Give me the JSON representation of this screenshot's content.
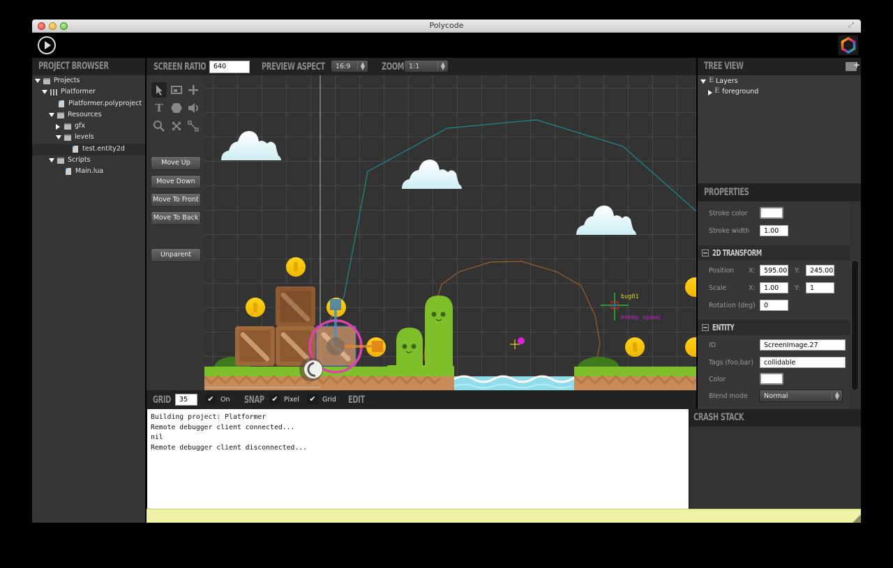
{
  "window": {
    "title": "Polycode"
  },
  "toolbar": {
    "play_icon": "play-circle-icon",
    "logo_icon": "polycode-hexagon-logo"
  },
  "project_browser": {
    "header": "PROJECT BROWSER",
    "items": [
      {
        "label": "Projects",
        "icon": "folder-icon",
        "expanded": true,
        "depth": 0
      },
      {
        "label": "Platformer",
        "icon": "project-icon",
        "expanded": true,
        "depth": 1
      },
      {
        "label": "Platformer.polyproject",
        "icon": "file-icon",
        "depth": 2
      },
      {
        "label": "Resources",
        "icon": "folder-icon",
        "expanded": true,
        "depth": 2
      },
      {
        "label": "gfx",
        "icon": "folder-icon",
        "expanded": false,
        "depth": 3
      },
      {
        "label": "levels",
        "icon": "folder-icon",
        "expanded": true,
        "depth": 3
      },
      {
        "label": "test.entity2d",
        "icon": "file-icon",
        "depth": 4,
        "selected": true
      },
      {
        "label": "Scripts",
        "icon": "folder-icon",
        "expanded": true,
        "depth": 2
      },
      {
        "label": "Main.lua",
        "icon": "file-icon",
        "depth": 3
      }
    ]
  },
  "editor_header": {
    "screen_ratio_label": "SCREEN RATIO",
    "screen_ratio_value": "640",
    "preview_aspect_label": "PREVIEW ASPECT",
    "preview_aspect_value": "16:9",
    "zoom_label": "ZOOM",
    "zoom_value": "1:1"
  },
  "tools": {
    "icons": [
      "select-arrow-icon",
      "image-icon",
      "crosshair-icon",
      "text-icon",
      "hexagon-shape-icon",
      "sound-icon",
      "zoom-icon",
      "move-icon",
      "link-icon"
    ],
    "buttons": {
      "move_up": "Move Up",
      "move_down": "Move Down",
      "move_to_front": "Move To Front",
      "move_to_back": "Move To Back",
      "unparent": "Unparent"
    }
  },
  "viewport": {
    "labels": {
      "entity_name": "bug01",
      "entity_tag": "enemy_spawn"
    }
  },
  "grid_bar": {
    "grid_label": "GRID",
    "grid_value": "35",
    "grid_on_label": "On",
    "grid_on_checked": true,
    "snap_label": "SNAP",
    "snap_pixel_label": "Pixel",
    "snap_pixel_checked": true,
    "snap_grid_label": "Grid",
    "snap_grid_checked": true,
    "edit_label": "EDIT"
  },
  "console": {
    "lines": [
      "Building project: Platformer",
      "Remote debugger client connected...",
      "nil",
      "Remote debugger client disconnected..."
    ]
  },
  "tree_view": {
    "header": "TREE VIEW",
    "items": [
      {
        "label": "Layers",
        "expanded": true
      },
      {
        "label": "foreground",
        "expanded": false
      }
    ]
  },
  "properties": {
    "header": "PROPERTIES",
    "stroke_color_label": "Stroke color",
    "stroke_color_value": "#ffffff",
    "stroke_width_label": "Stroke width",
    "stroke_width_value": "1.00",
    "transform": {
      "header": "2D TRANSFORM",
      "position_label": "Position",
      "position_x": "595.00",
      "position_y": "245.00",
      "scale_label": "Scale",
      "scale_x": "1.00",
      "scale_y": "1",
      "rotation_label": "Rotation (deg)",
      "rotation_value": "0",
      "x_label": "X:",
      "y_label": "Y:"
    },
    "entity": {
      "header": "ENTITY",
      "id_label": "ID",
      "id_value": "ScreenImage.27",
      "tags_label": "Tags (foo,bar)",
      "tags_value": "collidable",
      "color_label": "Color",
      "color_value": "#ffffff",
      "blend_label": "Blend mode",
      "blend_value": "Normal"
    }
  },
  "crash_stack": {
    "header": "CRASH STACK"
  }
}
